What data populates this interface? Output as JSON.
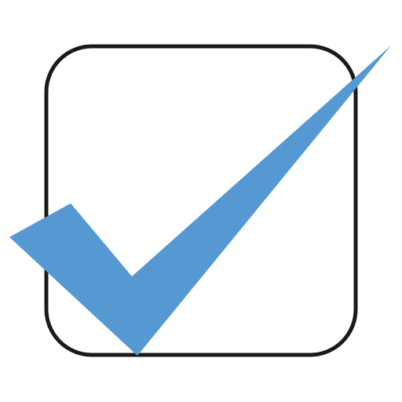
{
  "icon": {
    "name": "checkbox-checked-icon",
    "state": "checked",
    "colors": {
      "check": "#5699d2",
      "box_border": "#1a1a1a",
      "box_fill": "#ffffff",
      "background": "#ffffff"
    }
  }
}
